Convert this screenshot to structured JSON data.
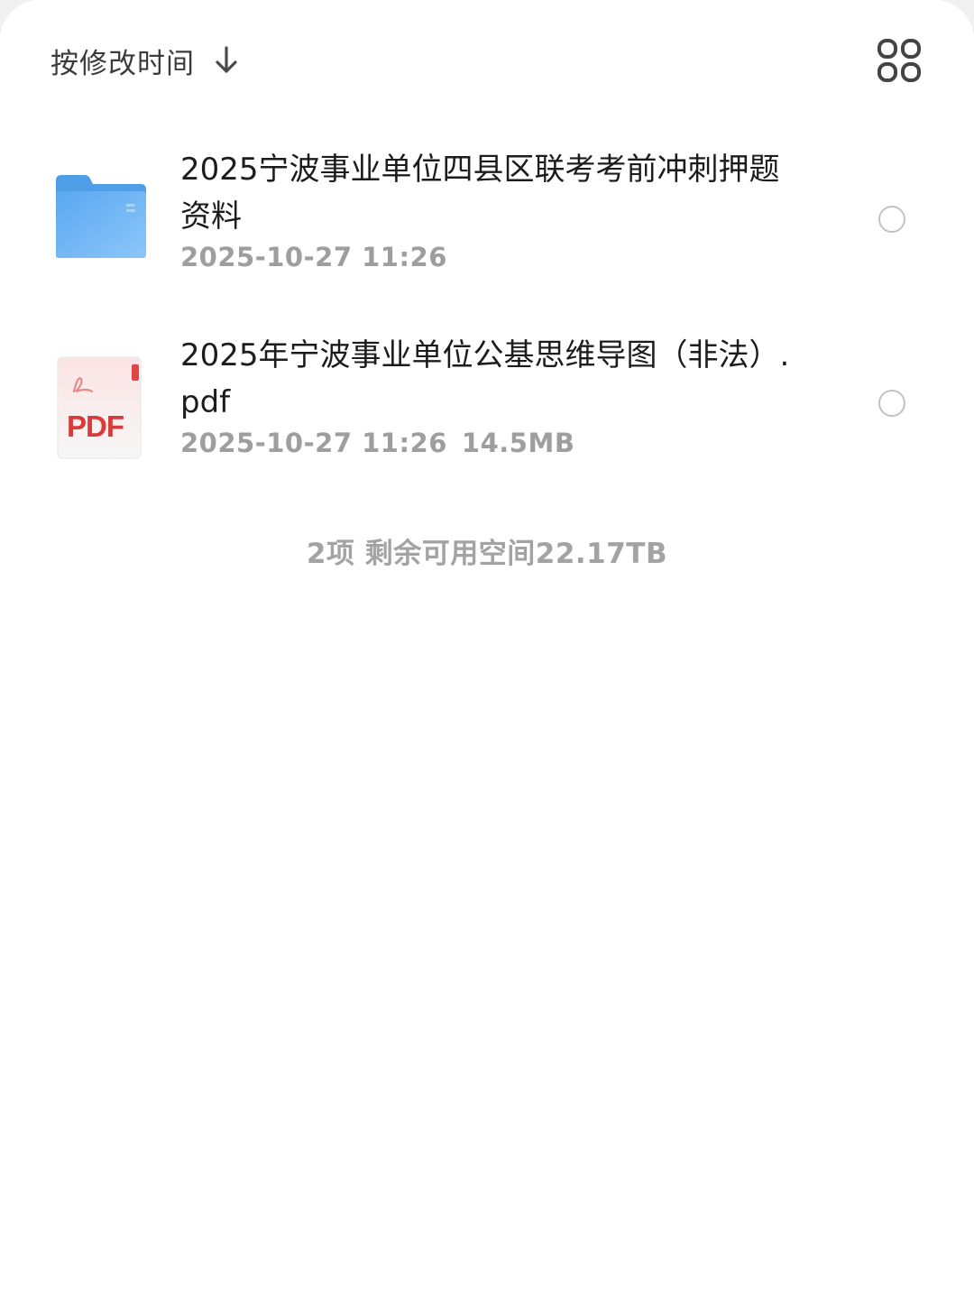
{
  "toolbar": {
    "sort_label": "按修改时间",
    "sort_direction_icon": "arrow-down-icon",
    "view_toggle_icon": "grid-view-icon"
  },
  "files": [
    {
      "type": "folder",
      "icon": "folder-icon",
      "name": "2025宁波事业单位四县区联考考前冲刺押题资料",
      "modified": "2025-10-27 11:26",
      "size": ""
    },
    {
      "type": "pdf",
      "icon": "pdf-icon",
      "icon_label": "PDF",
      "name": "2025年宁波事业单位公基思维导图（非法）.pdf",
      "modified": "2025-10-27 11:26",
      "size": "14.5MB"
    }
  ],
  "summary": "2项 剩余可用空间22.17TB",
  "colors": {
    "folder_blue": "#6cb4f5",
    "pdf_red": "#d93a3a",
    "meta_gray": "#9e9e9e"
  }
}
